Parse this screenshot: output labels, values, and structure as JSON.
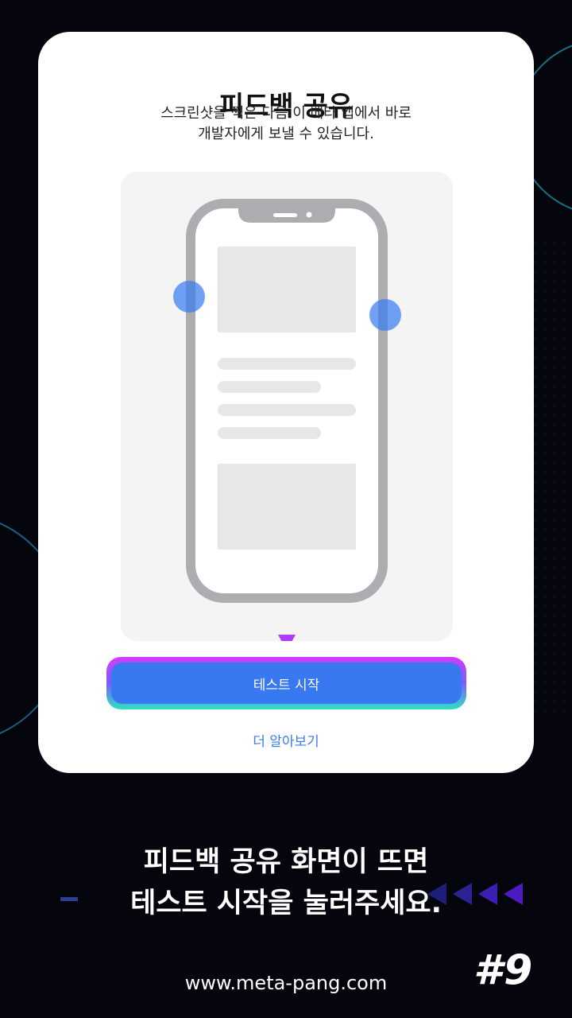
{
  "card": {
    "title": "피드백 공유",
    "subtitle_line1": "스크린샷을 찍은 다음 이 베타 앱에서 바로",
    "subtitle_line2": "개발자에게 보낼 수 있습니다.",
    "start_button_label": "테스트 시작",
    "learn_more_label": "더 알아보기"
  },
  "caption": {
    "line1": "피드백 공유 화면이 뜨면",
    "line2": "테스트 시작을 눌러주세요."
  },
  "footer": {
    "url": "www.meta-pang.com",
    "step": "#9"
  },
  "colors": {
    "accent_blue": "#3879f2",
    "link_blue": "#3d7ee6",
    "highlight_gradient": [
      "#d43cff",
      "#2fe0c0"
    ],
    "background": "#04050d"
  }
}
